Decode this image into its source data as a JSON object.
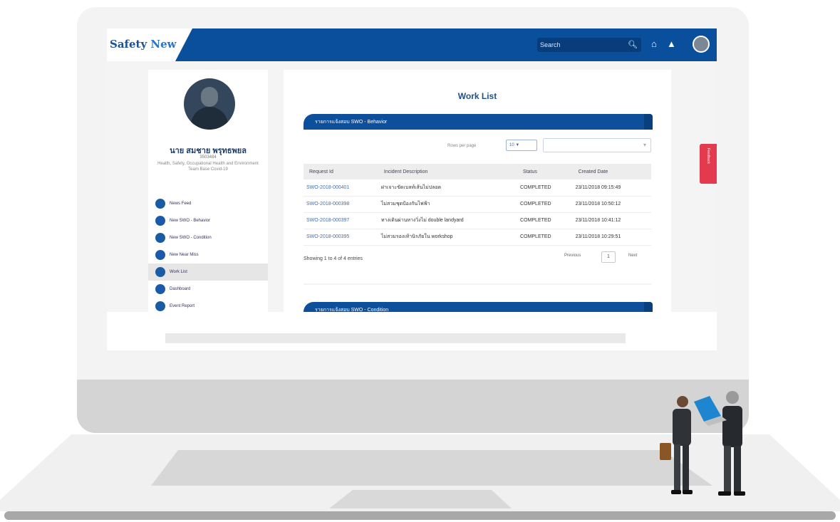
{
  "app": {
    "logo_prefix": "Safety ",
    "logo_suffix": "New",
    "search_placeholder": "Search"
  },
  "header_icons": [
    "search-icon",
    "home-icon",
    "bell-icon",
    "avatar-icon"
  ],
  "profile": {
    "name": "นาย สมชาย พรุทธพยล",
    "employee_id": "3503484",
    "department": "Health, Safety, Occupational Health and Environment Team Base Covid-19"
  },
  "menu": [
    {
      "label": "News Feed",
      "icon": "news-icon"
    },
    {
      "label": "New SWO - Behavior",
      "icon": "behavior-icon"
    },
    {
      "label": "New SWO - Condition",
      "icon": "condition-icon"
    },
    {
      "label": "New Near Miss",
      "icon": "near-miss-icon"
    },
    {
      "label": "Work List",
      "icon": "worklist-icon",
      "active": true
    },
    {
      "label": "Dashboard",
      "icon": "dashboard-icon"
    },
    {
      "label": "Event Report",
      "icon": "report-icon"
    }
  ],
  "worklist": {
    "title": "Work List",
    "panel1_title": "รายการแจ้งสอบ SWO - Behavior",
    "panel2_title": "รายการแจ้งสอบ SWO - Condition",
    "rows_per_page_label": "Rows per page",
    "rows_per_page_value": "10 ▼",
    "columns": [
      "Request Id",
      "Incident Description",
      "Status",
      "Created Date"
    ],
    "rows": [
      {
        "id": "SWO-2018-000401",
        "desc": "ฝาเจาะขัดเบลท์เส้นไม่ปลอด",
        "status": "COMPLETED",
        "date": "23/11/2018 09:15:49"
      },
      {
        "id": "SWO-2018-000398",
        "desc": "ไม่สวมชุดป้องกันไฟฟ้า",
        "status": "COMPLETED",
        "date": "23/11/2018 10:50:12"
      },
      {
        "id": "SWO-2018-000397",
        "desc": "ทางเดินผ่านหางวิ่งไม่ double landyard",
        "status": "COMPLETED",
        "date": "23/11/2018 10:41:12"
      },
      {
        "id": "SWO-2018-000395",
        "desc": "ไม่สวมรองเท้านิรภัยใน workshop",
        "status": "COMPLETED",
        "date": "23/11/2018 10:29:51"
      }
    ],
    "showing_text": "Showing 1 to 4 of 4 entries",
    "previous_label": "Previous",
    "current_page": "1",
    "next_label": "Next"
  },
  "side_tab_label": "Feedback"
}
